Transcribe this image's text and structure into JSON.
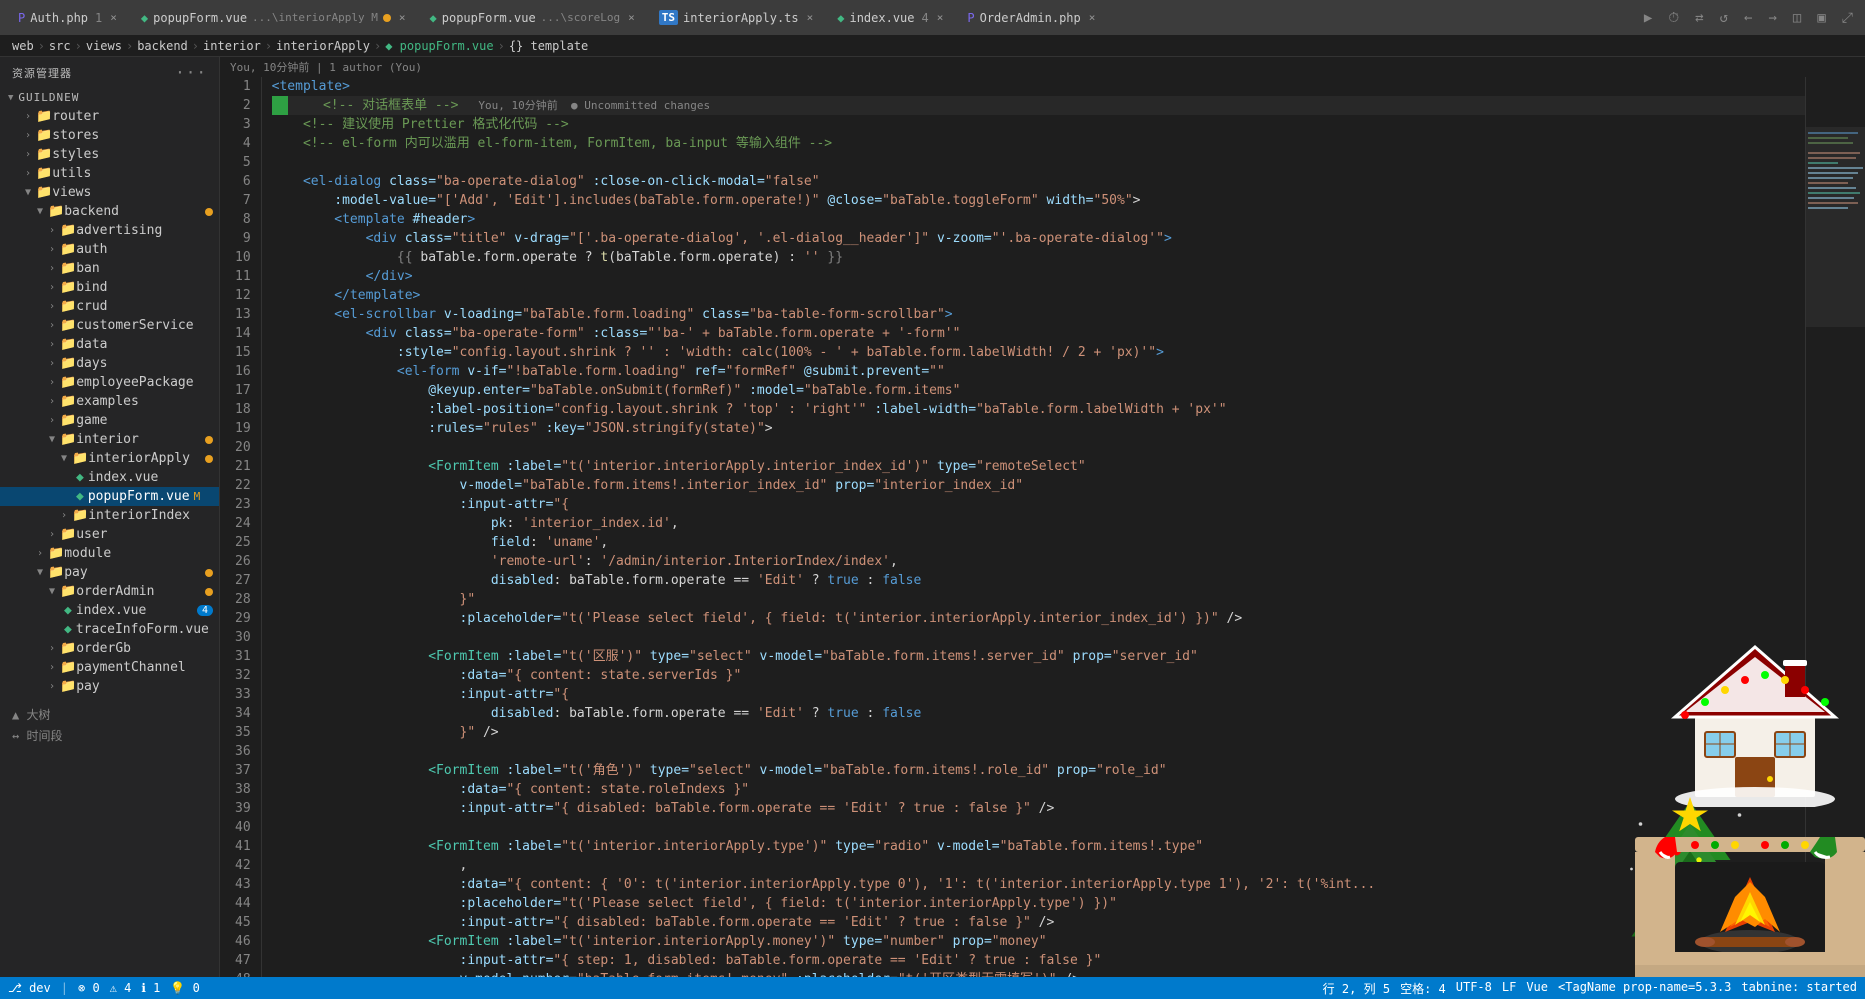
{
  "titlebar": {
    "tabs": [
      {
        "id": "auth-php",
        "label": "Auth.php",
        "num": "1",
        "icon": "php",
        "active": false,
        "modified": false
      },
      {
        "id": "popupform-interior",
        "label": "popupForm.vue",
        "sub": "...\\interiorApply M",
        "icon": "vue",
        "active": false,
        "modified": true
      },
      {
        "id": "popupform-score",
        "label": "popupForm.vue",
        "sub": "...\\scoreLog",
        "icon": "vue",
        "active": false,
        "modified": false
      },
      {
        "id": "interiorapply-ts",
        "label": "interiorApply.ts",
        "icon": "ts",
        "active": false,
        "modified": false
      },
      {
        "id": "index-vue",
        "label": "index.vue",
        "num": "4",
        "icon": "vue",
        "active": false,
        "modified": false
      },
      {
        "id": "orderadmin-php",
        "label": "OrderAdmin.php",
        "icon": "php",
        "active": false,
        "modified": false
      }
    ]
  },
  "breadcrumb": {
    "parts": [
      "web",
      "src",
      "views",
      "backend",
      "interior",
      "interiorApply",
      "popupForm.vue",
      "{} template"
    ]
  },
  "git_info": "You, 10分钟前 | 1 author (You)",
  "editor": {
    "filename": "popupForm.vue",
    "lines": [
      {
        "num": 1,
        "code": "<template>"
      },
      {
        "num": 2,
        "code": "    <!-- 对话框表单 -->",
        "git_annotation": "You, 10分钟前  ● Uncommitted changes"
      },
      {
        "num": 3,
        "code": "    <!-- 建议使用 Prettier 格式化代码 -->"
      },
      {
        "num": 4,
        "code": "    <!-- el-form 内可以滥用 el-form-item, FormItem, ba-input 等输入组件 -->"
      },
      {
        "num": 5,
        "code": ""
      },
      {
        "num": 6,
        "code": "    <el-dialog class=\"ba-operate-dialog\" :close-on-click-modal=\"false\""
      },
      {
        "num": 7,
        "code": "        :model-value=\"['Add', 'Edit'].includes(baTable.form.operate!)\" @close=\"baTable.toggleForm\" width=\"50%\">"
      },
      {
        "num": 8,
        "code": "        <template #header>"
      },
      {
        "num": 9,
        "code": "            <div class=\"title\" v-drag=\"['.ba-operate-dialog', '.el-dialog__header']\" v-zoom=\"'.ba-operate-dialog'\">"
      },
      {
        "num": 10,
        "code": "                {{ baTable.form.operate ? t(baTable.form.operate) : '' }}"
      },
      {
        "num": 11,
        "code": "            </div>"
      },
      {
        "num": 12,
        "code": "        </template>"
      },
      {
        "num": 13,
        "code": "        <el-scrollbar v-loading=\"baTable.form.loading\" class=\"ba-table-form-scrollbar\">"
      },
      {
        "num": 14,
        "code": "            <div class=\"ba-operate-form\" :class=\"'ba-' + baTable.form.operate + '-form'\""
      },
      {
        "num": 15,
        "code": "                :style=\"config.layout.shrink ? '' : 'width: calc(100% - ' + baTable.form.labelWidth! / 2 + 'px)'\">"
      },
      {
        "num": 16,
        "code": "                <el-form v-if=\"!baTable.form.loading\" ref=\"formRef\" @submit.prevent=\"\""
      },
      {
        "num": 17,
        "code": "                    @keyup.enter=\"baTable.onSubmit(formRef)\" :model=\"baTable.form.items\""
      },
      {
        "num": 18,
        "code": "                    :label-position=\"config.layout.shrink ? 'top' : 'right'\" :label-width=\"baTable.form.labelWidth + 'px'\""
      },
      {
        "num": 19,
        "code": "                    :rules=\"rules\" :key=\"JSON.stringify(state)\">"
      },
      {
        "num": 20,
        "code": ""
      },
      {
        "num": 21,
        "code": "                    <FormItem :label=\"t('interior.interiorApply.interior_index_id')\" type=\"remoteSelect\""
      },
      {
        "num": 22,
        "code": "                        v-model=\"baTable.form.items!.interior_index_id\" prop=\"interior_index_id\""
      },
      {
        "num": 23,
        "code": "                        :input-attr=\"{"
      },
      {
        "num": 24,
        "code": "                            pk: 'interior_index.id',"
      },
      {
        "num": 25,
        "code": "                            field: 'uname',"
      },
      {
        "num": 26,
        "code": "                            'remote-url': '/admin/interior.InteriorIndex/index',"
      },
      {
        "num": 27,
        "code": "                            disabled: baTable.form.operate == 'Edit' ? true : false"
      },
      {
        "num": 28,
        "code": "                        }\""
      },
      {
        "num": 29,
        "code": "                        :placeholder=\"t('Please select field', { field: t('interior.interiorApply.interior_index_id') })\" />"
      },
      {
        "num": 30,
        "code": ""
      },
      {
        "num": 31,
        "code": "                    <FormItem :label=\"t('区服')\" type=\"select\" v-model=\"baTable.form.items!.server_id\" prop=\"server_id\""
      },
      {
        "num": 32,
        "code": "                        :data=\"{ content: state.serverIds }\""
      },
      {
        "num": 33,
        "code": "                        :input-attr=\"{"
      },
      {
        "num": 34,
        "code": "                            disabled: baTable.form.operate == 'Edit' ? true : false"
      },
      {
        "num": 35,
        "code": "                        }\" />"
      },
      {
        "num": 36,
        "code": ""
      },
      {
        "num": 37,
        "code": "                    <FormItem :label=\"t('角色')\" type=\"select\" v-model=\"baTable.form.items!.role_id\" prop=\"role_id\""
      },
      {
        "num": 38,
        "code": "                        :data=\"{ content: state.roleIndexs }\""
      },
      {
        "num": 39,
        "code": "                        :input-attr=\"{ disabled: baTable.form.operate == 'Edit' ? true : false }\" />"
      },
      {
        "num": 40,
        "code": ""
      },
      {
        "num": 41,
        "code": "                    <FormItem :label=\"t('interior.interiorApply.type')\" type=\"radio\" v-model=\"baTable.form.items!.type\""
      },
      {
        "num": 42,
        "code": "                        ,"
      },
      {
        "num": 43,
        "code": "                        :data=\"{ content: { '0': t('interior.interiorApply.type 0'), '1': t('interior.interiorApply.type 1'), '2': t('%int..."
      },
      {
        "num": 44,
        "code": "                        :placeholder=\"t('Please select field', { field: t('interior.interiorApply.type') })\""
      },
      {
        "num": 45,
        "code": "                        :input-attr=\"{ disabled: baTable.form.operate == 'Edit' ? true : false }\" />"
      },
      {
        "num": 46,
        "code": "                    <FormItem :label=\"t('interior.interiorApply.money')\" type=\"number\" prop=\"money\""
      },
      {
        "num": 47,
        "code": "                        :input-attr=\"{ step: 1, disabled: baTable.form.operate == 'Edit' ? true : false }\""
      },
      {
        "num": 48,
        "code": "                        v-model.number=\"baTable.form.items!.money\" :placeholder=\"t('开区类型无需填写')\" />"
      }
    ]
  },
  "sidebar": {
    "title": "资源管理器",
    "project": "GUILDNEW",
    "tree": [
      {
        "id": "router",
        "label": "router",
        "type": "folder",
        "indent": 1,
        "expanded": false
      },
      {
        "id": "stores",
        "label": "stores",
        "type": "folder",
        "indent": 1,
        "expanded": false
      },
      {
        "id": "styles",
        "label": "styles",
        "type": "folder",
        "indent": 1,
        "expanded": false
      },
      {
        "id": "utils",
        "label": "utils",
        "type": "folder",
        "indent": 1,
        "expanded": false
      },
      {
        "id": "views",
        "label": "views",
        "type": "folder",
        "indent": 1,
        "expanded": true
      },
      {
        "id": "backend",
        "label": "backend",
        "type": "folder",
        "indent": 2,
        "expanded": true,
        "badge": ""
      },
      {
        "id": "advertising",
        "label": "advertising",
        "type": "folder",
        "indent": 3,
        "expanded": false
      },
      {
        "id": "auth",
        "label": "auth",
        "type": "folder",
        "indent": 3,
        "expanded": false
      },
      {
        "id": "ban",
        "label": "ban",
        "type": "folder",
        "indent": 3,
        "expanded": false
      },
      {
        "id": "bind",
        "label": "bind",
        "type": "folder",
        "indent": 3,
        "expanded": false
      },
      {
        "id": "crud",
        "label": "crud",
        "type": "folder",
        "indent": 3,
        "expanded": false
      },
      {
        "id": "customerService",
        "label": "customerService",
        "type": "folder",
        "indent": 3,
        "expanded": false
      },
      {
        "id": "data",
        "label": "data",
        "type": "folder",
        "indent": 3,
        "expanded": false
      },
      {
        "id": "days",
        "label": "days",
        "type": "folder",
        "indent": 3,
        "expanded": false
      },
      {
        "id": "employeePackage",
        "label": "employeePackage",
        "type": "folder",
        "indent": 3,
        "expanded": false
      },
      {
        "id": "examples",
        "label": "examples",
        "type": "folder",
        "indent": 3,
        "expanded": false
      },
      {
        "id": "game",
        "label": "game",
        "type": "folder",
        "indent": 3,
        "expanded": false
      },
      {
        "id": "interior",
        "label": "interior",
        "type": "folder",
        "indent": 3,
        "expanded": true,
        "dot": true
      },
      {
        "id": "interiorApply",
        "label": "interiorApply",
        "type": "folder",
        "indent": 4,
        "expanded": true,
        "dot": true
      },
      {
        "id": "index-vue",
        "label": "index.vue",
        "type": "vue",
        "indent": 5,
        "expanded": false
      },
      {
        "id": "popupForm-vue",
        "label": "popupForm.vue",
        "type": "vue",
        "indent": 5,
        "expanded": false,
        "active": true,
        "modified": true
      },
      {
        "id": "interiorIndex",
        "label": "interiorIndex",
        "type": "folder",
        "indent": 4,
        "expanded": false
      },
      {
        "id": "user",
        "label": "user",
        "type": "folder",
        "indent": 3,
        "expanded": false
      },
      {
        "id": "module",
        "label": "module",
        "type": "folder",
        "indent": 2,
        "expanded": false
      },
      {
        "id": "pay",
        "label": "pay",
        "type": "folder",
        "indent": 2,
        "expanded": false,
        "dot": true
      },
      {
        "id": "orderAdmin",
        "label": "orderAdmin",
        "type": "folder",
        "indent": 3,
        "expanded": true,
        "dot": true
      },
      {
        "id": "index-vue-2",
        "label": "index.vue",
        "type": "vue",
        "indent": 4,
        "badge": "4"
      },
      {
        "id": "traceInfoForm-vue",
        "label": "traceInfoForm.vue",
        "type": "vue",
        "indent": 4
      },
      {
        "id": "orderGb",
        "label": "orderGb",
        "type": "folder",
        "indent": 3
      },
      {
        "id": "paymentChannel",
        "label": "paymentChannel",
        "type": "folder",
        "indent": 3
      },
      {
        "id": "pay2",
        "label": "pay",
        "type": "folder",
        "indent": 3
      }
    ]
  },
  "statusbar": {
    "branch": "dev",
    "errors": "0",
    "warnings": "4",
    "info": "1",
    "hints": "0",
    "row": "2",
    "col": "5",
    "spaces": "4",
    "encoding": "UTF-8",
    "line_endings": "LF",
    "language": "Vue",
    "tagname": "<TagName prop-name=5.3.3",
    "tabnine": "tabnine: started"
  }
}
